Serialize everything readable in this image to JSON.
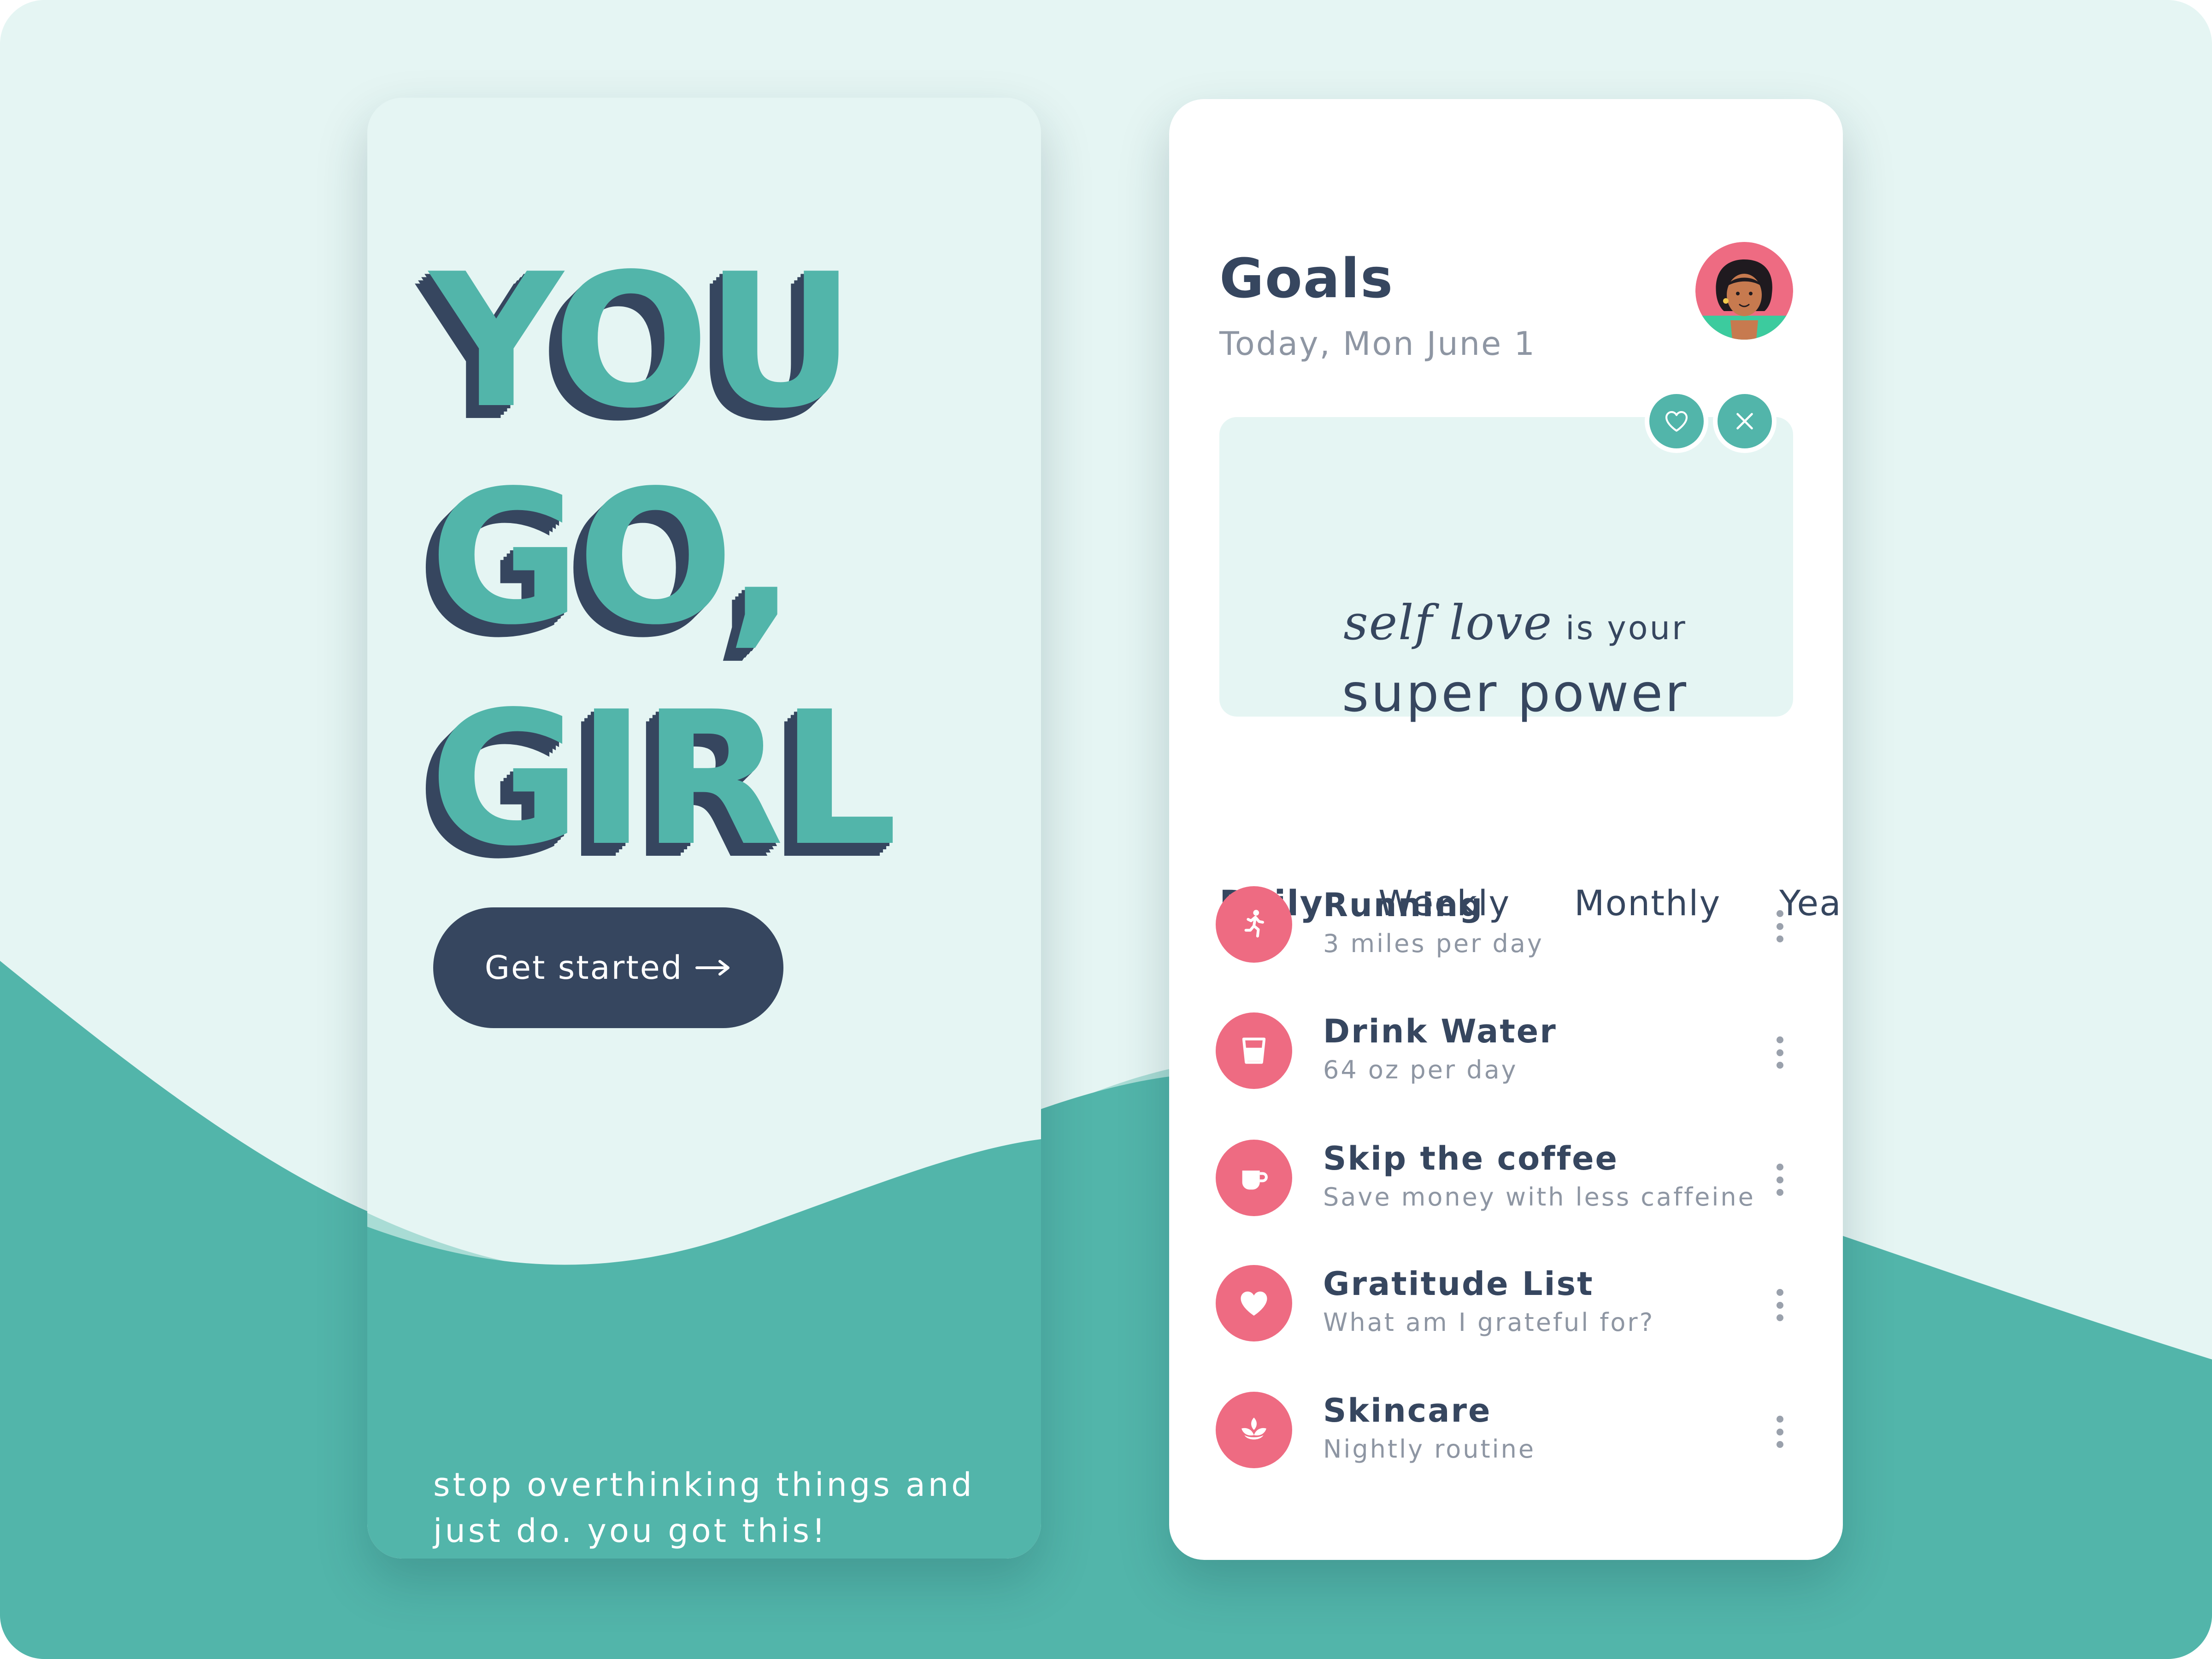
{
  "colors": {
    "background": "#e5f5f3",
    "teal": "#52b5aa",
    "navy": "#36465f",
    "pink": "#ee6b82",
    "muted_text": "#8e96a3"
  },
  "welcome_screen": {
    "hero_lines": [
      "YOU",
      "GO,",
      "GIRL"
    ],
    "start_button": {
      "label": "Get started",
      "icon": "arrow-right-icon"
    },
    "tagline": "stop overthinking things and just do. you got this!"
  },
  "goals_screen": {
    "title": "Goals",
    "date": "Today, Mon June 1",
    "avatar_icon": "user-avatar",
    "quote": {
      "script_text": "self love",
      "small_text": "is your",
      "big_text": "super power",
      "like_icon": "heart-outline-icon",
      "dismiss_icon": "close-icon"
    },
    "tabs": [
      {
        "label": "Daily",
        "active": true
      },
      {
        "label": "Weekly",
        "active": false
      },
      {
        "label": "Monthly",
        "active": false
      },
      {
        "label": "Yearly",
        "active": false
      }
    ],
    "goals": [
      {
        "title": "Running",
        "subtitle": "3 miles per day",
        "icon": "running-icon"
      },
      {
        "title": "Drink Water",
        "subtitle": "64 oz per day",
        "icon": "water-glass-icon"
      },
      {
        "title": "Skip the coffee",
        "subtitle": "Save money with less caffeine",
        "icon": "coffee-cup-icon"
      },
      {
        "title": "Gratitude List",
        "subtitle": "What am I grateful for?",
        "icon": "heart-icon"
      },
      {
        "title": "Skincare",
        "subtitle": "Nightly routine",
        "icon": "lotus-icon"
      }
    ],
    "more_icon": "more-vertical-icon"
  }
}
